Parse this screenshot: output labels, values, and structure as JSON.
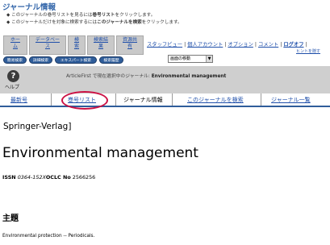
{
  "page_title": "ジャーナル情報",
  "help_lines": {
    "line1_pre": "このジャーナルの巻号リストを見るには",
    "line1_bold": "巻号リスト",
    "line1_post": "をクリックします。",
    "line2_pre": "このジャーナルだけを対象に検索するには",
    "line2_bold": "このジャーナルを検索",
    "line2_post": "をクリックします。"
  },
  "nav_tabs": [
    {
      "line1": "ホー",
      "line2": "ム"
    },
    {
      "line1": "データベー",
      "line2": "ス"
    },
    {
      "line1": "検",
      "line2": "索"
    },
    {
      "line1": "検索結",
      "line2": "果"
    },
    {
      "line1": "資源共",
      "line2": "有"
    }
  ],
  "links": {
    "staff_view": "スタッフビュー",
    "personal_account": "個人アカウント",
    "options": "オプション",
    "comment": "コメント",
    "logout": "ログオフ",
    "hint": "ヒントを隠す"
  },
  "search_pills": [
    "簡易検索",
    "詳細検索",
    "エキスパート検索",
    "検索履歴"
  ],
  "jump_select": {
    "value": "画面の移動"
  },
  "help": {
    "icon": "?",
    "label": "ヘルプ"
  },
  "context": {
    "pre": "ArticleFirst で現在選択中のジャーナル:",
    "journal": "Environmental management"
  },
  "tabs": {
    "latest": "最新号",
    "issues": "巻号リスト",
    "info": "ジャーナル情報",
    "search_journal": "このジャーナルを検索",
    "journal_list": "ジャーナル一覧"
  },
  "journal": {
    "publisher": "Springer-Verlag]",
    "title": "Environmental management",
    "issn_label": "ISSN",
    "issn_value": "0364-152X",
    "oclc_label": "OCLC No",
    "oclc_value": "2566256",
    "subject_heading": "主題",
    "subject_value": "Environmental protection -- Periodicals."
  },
  "colors": {
    "title_blue": "#3366aa",
    "link_blue": "#1f4faa",
    "pill_blue": "#2f5d9a",
    "grey_bar": "#cfcfcf",
    "circle_red": "#cc1144"
  }
}
